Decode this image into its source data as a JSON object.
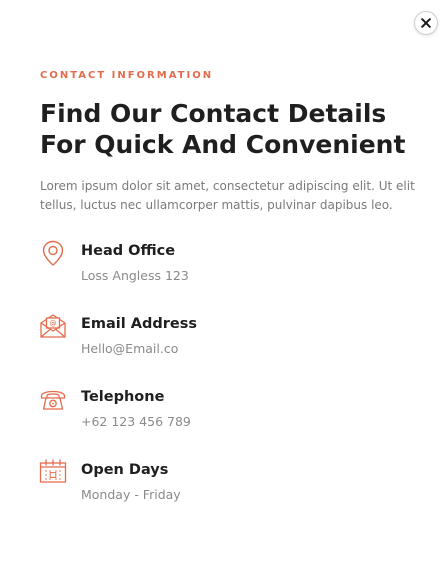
{
  "close_icon": "close-icon",
  "eyebrow": "CONTACT INFORMATION",
  "title": "Find Our Contact Details For Quick And Convenient",
  "description": "Lorem ipsum dolor sit amet, consectetur adipiscing elit. Ut elit tellus, luctus nec ullamcorper mattis, pulvinar dapibus leo.",
  "accent_color": "#e36c4d",
  "items": [
    {
      "icon": "location-pin-icon",
      "label": "Head Office",
      "value": "Loss Angless 123"
    },
    {
      "icon": "envelope-icon",
      "label": "Email Address",
      "value": "Hello@Email.co"
    },
    {
      "icon": "telephone-icon",
      "label": "Telephone",
      "value": "+62 123 456 789"
    },
    {
      "icon": "calendar-icon",
      "label": "Open Days",
      "value": "Monday - Friday"
    }
  ]
}
